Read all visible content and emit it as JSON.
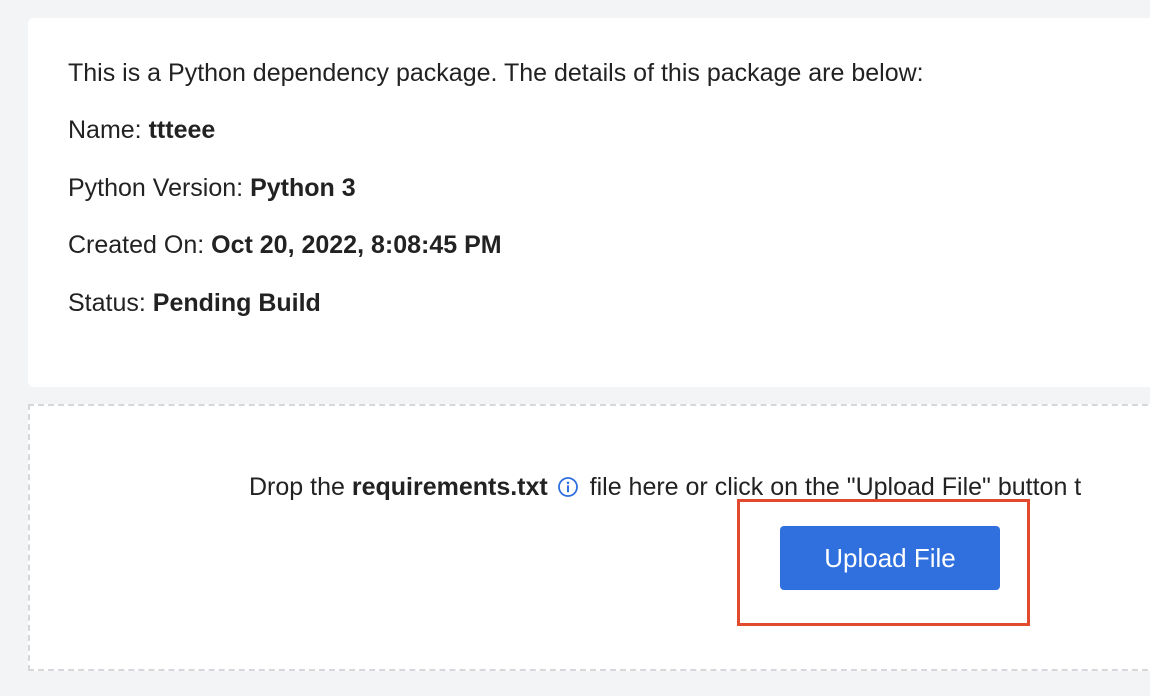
{
  "details": {
    "intro": "This is a Python dependency package. The details of this package are below:",
    "name_label": "Name:",
    "name_value": "ttteee",
    "python_version_label": "Python Version:",
    "python_version_value": "Python 3",
    "created_on_label": "Created On:",
    "created_on_value": "Oct 20, 2022, 8:08:45 PM",
    "status_label": "Status:",
    "status_value": "Pending Build"
  },
  "drop_zone": {
    "text_before": "Drop the",
    "filename": "requirements.txt",
    "info_icon": "info-circle-icon",
    "text_after": "file here or click on the \"Upload File\" button t",
    "upload_button_label": "Upload File"
  },
  "colors": {
    "accent_button": "#2f6fde",
    "highlight_box": "#e24a2d",
    "info_icon": "#2f6fde",
    "page_background": "#f3f4f6"
  }
}
